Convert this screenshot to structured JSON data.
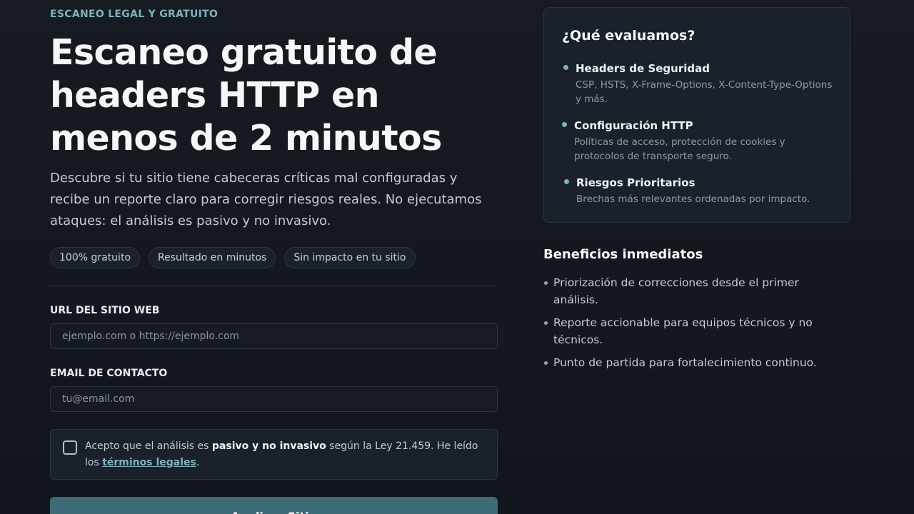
{
  "hero": {
    "eyebrow": "ESCANEO LEGAL Y GRATUITO",
    "title": "Escaneo gratuito de headers HTTP en menos de 2 minutos",
    "lead": "Descubre si tu sitio tiene cabeceras críticas mal configuradas y recibe un reporte claro para corregir riesgos reales. No ejecutamos ataques: el análisis es pasivo y no invasivo.",
    "chips": [
      "100% gratuito",
      "Resultado en minutos",
      "Sin impacto en tu sitio"
    ]
  },
  "form": {
    "url_label": "URL DEL SITIO WEB",
    "url_placeholder": "ejemplo.com o https://ejemplo.com",
    "url_value": "",
    "email_label": "EMAIL DE CONTACTO",
    "email_placeholder": "tu@email.com",
    "email_value": "",
    "consent": {
      "checked": false,
      "text_before": "Acepto que el análisis es ",
      "text_bold": "pasivo y no invasivo",
      "text_after": " según la Ley 21.459. He leído los ",
      "link_label": "términos legales",
      "text_end": "."
    },
    "submit_label": "Analizar Sitio"
  },
  "evaluation": {
    "title": "¿Qué evaluamos?",
    "items": [
      {
        "title": "Headers de Seguridad",
        "desc": "CSP, HSTS, X-Frame-Options, X-Content-Type-Options y más."
      },
      {
        "title": "Configuración HTTP",
        "desc": "Políticas de acceso, protección de cookies y protocolos de transporte seguro."
      },
      {
        "title": "Riesgos Prioritarios",
        "desc": "Brechas más relevantes ordenadas por impacto."
      }
    ]
  },
  "benefits": {
    "title": "Beneficios inmediatos",
    "items": [
      "Priorización de correcciones desde el primer análisis.",
      "Reporte accionable para equipos técnicos y no técnicos.",
      "Punto de partida para fortalecimiento continuo."
    ]
  },
  "colors": {
    "accent": "#7fb3bd",
    "button": "#3d6b78",
    "background": "#12171d",
    "card": "#1a212a"
  }
}
